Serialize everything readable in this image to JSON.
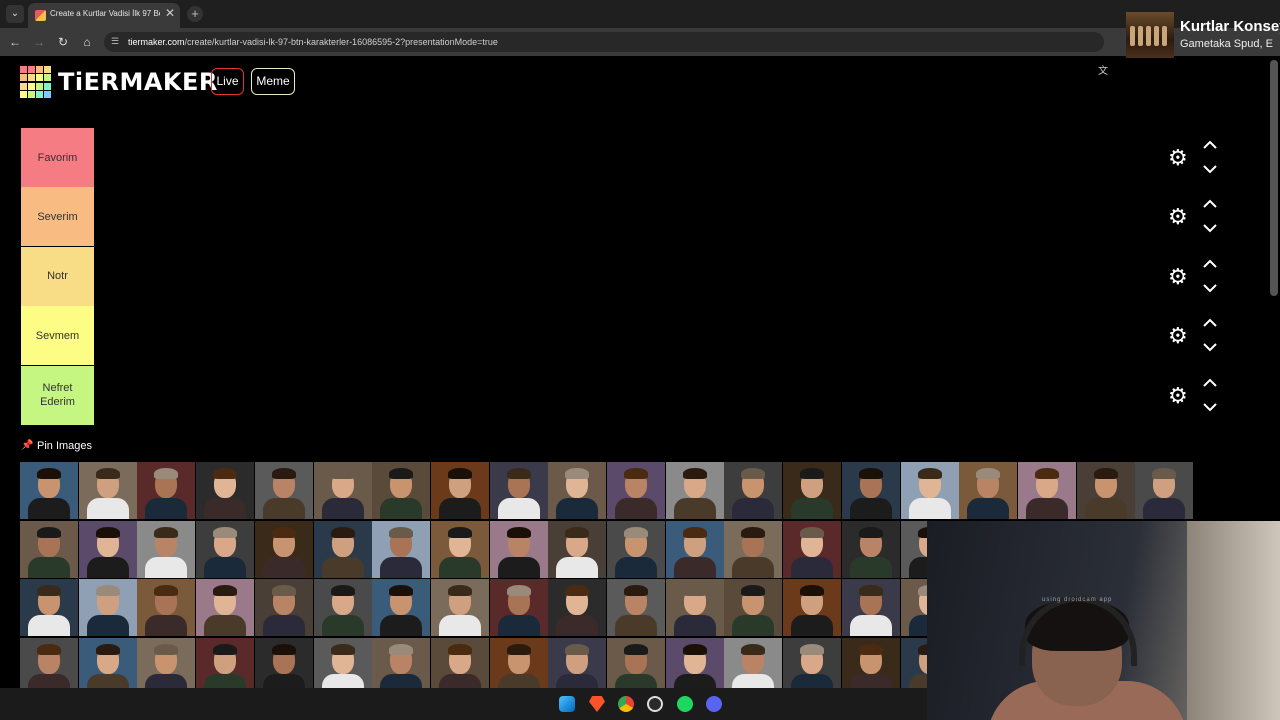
{
  "browser": {
    "tab_title": "Create a Kurtlar Vadisi İlk 97 Bö...",
    "tab_close": "✕",
    "new_tab": "+",
    "url_host": "tiermaker.com",
    "url_path": "/create/kurtlar-vadisi-lk-97-btn-karakterler-16086595-2?presentationMode=true"
  },
  "media": {
    "title": "Kurtlar Konsey",
    "subtitle": "Gametaka Spud, E"
  },
  "header": {
    "logo_text": "TiERMAKER",
    "live_label": "Live",
    "meme_label": "Meme"
  },
  "tiers": [
    {
      "label": "Favorim",
      "color": "#f47c82"
    },
    {
      "label": "Severim",
      "color": "#f8bb82"
    },
    {
      "label": "Notr",
      "color": "#f9dd86"
    },
    {
      "label": "Sevmem",
      "color": "#fdfd86"
    },
    {
      "label": "Nefret Ederim",
      "color": "#c5f682"
    }
  ],
  "pin": {
    "label": "Pin Images",
    "icon": "pushpin-icon"
  },
  "webcam": {
    "overlay_text": "using droidcam app"
  },
  "taskbar": {
    "icons": [
      "windows-start-icon",
      "brave-icon",
      "chrome-icon",
      "obs-icon",
      "spotify-icon",
      "discord-icon"
    ]
  }
}
